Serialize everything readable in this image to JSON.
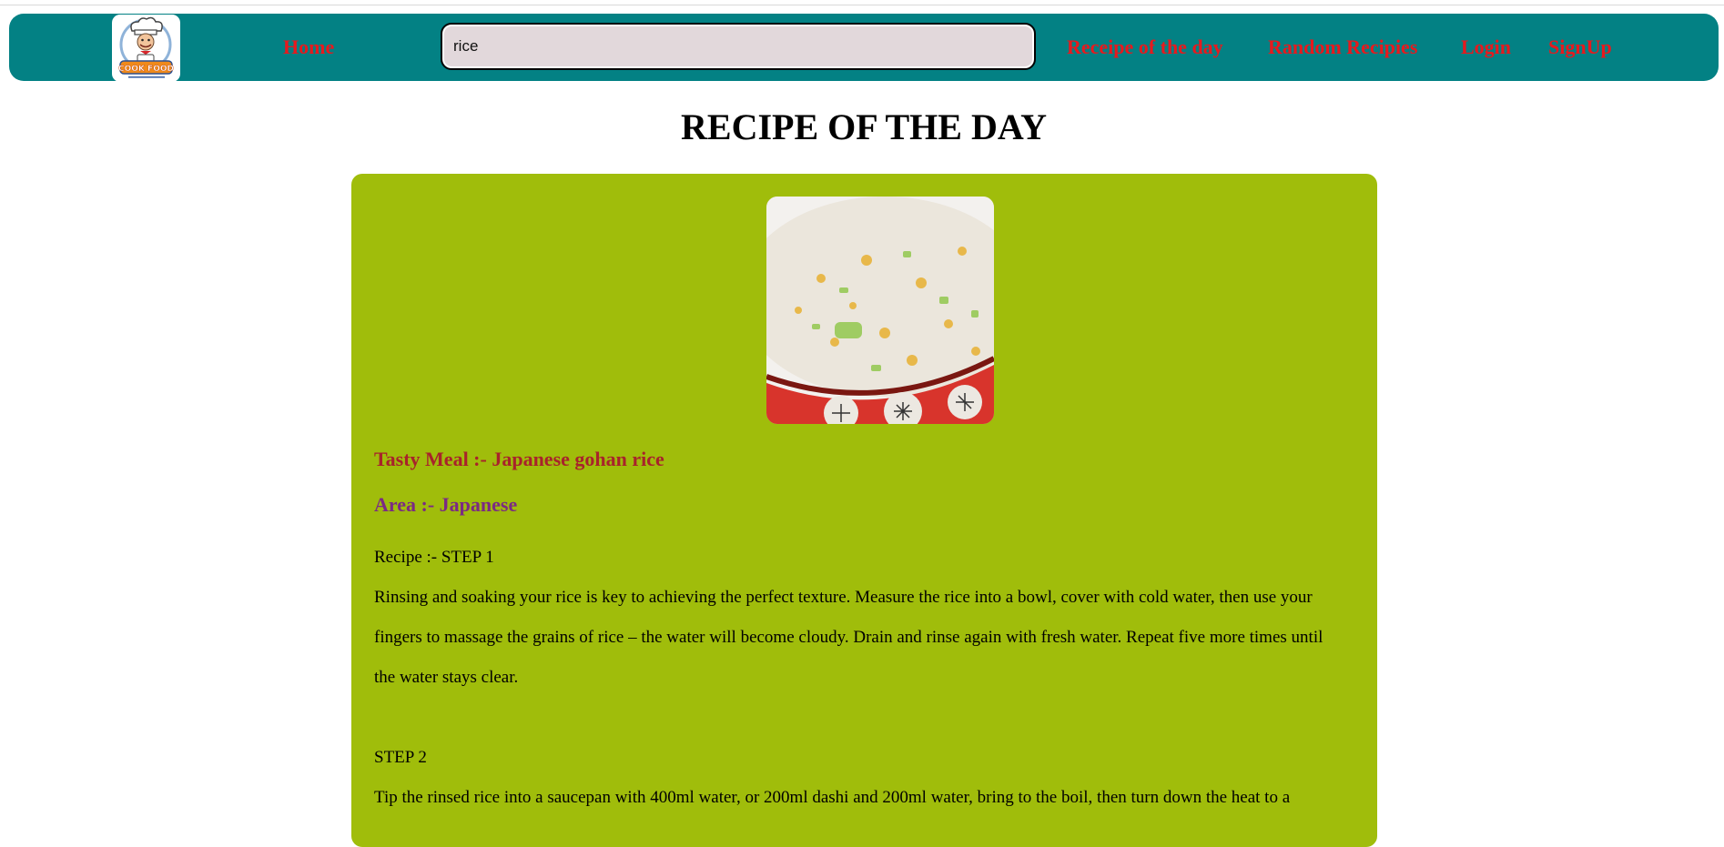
{
  "navbar": {
    "logo_label": "COOK FOOD",
    "home": "Home",
    "search_value": "rice",
    "recipe_of_the_day": "Receipe of the day",
    "random_recipes": "Random Recipies",
    "login": "Login",
    "signup": "SignUp"
  },
  "page": {
    "title": "RECIPE OF THE DAY"
  },
  "recipe": {
    "meal_name": "Tasty Meal :- Japanese gohan rice",
    "area": "Area :- Japanese",
    "instructions": "Recipe :- STEP 1\nRinsing and soaking your rice is key to achieving the perfect texture. Measure the rice into a bowl, cover with cold water, then use your fingers to massage the grains of rice – the water will become cloudy. Drain and rinse again with fresh water. Repeat five more times until the water stays clear.\n\nSTEP 2\nTip the rinsed rice into a saucepan with 400ml water, or 200ml dashi and 200ml water, bring to the boil, then turn down the heat to a"
  },
  "colors": {
    "navbar_bg": "#038184",
    "nav_link": "#e8191d",
    "card_bg": "#a0bd0b",
    "meal_name": "#a8232b",
    "area": "#7b2a84",
    "search_bg": "#e2d8db"
  },
  "icons": {
    "logo": "chef-logo-icon",
    "dish": "rice-bowl-image"
  }
}
